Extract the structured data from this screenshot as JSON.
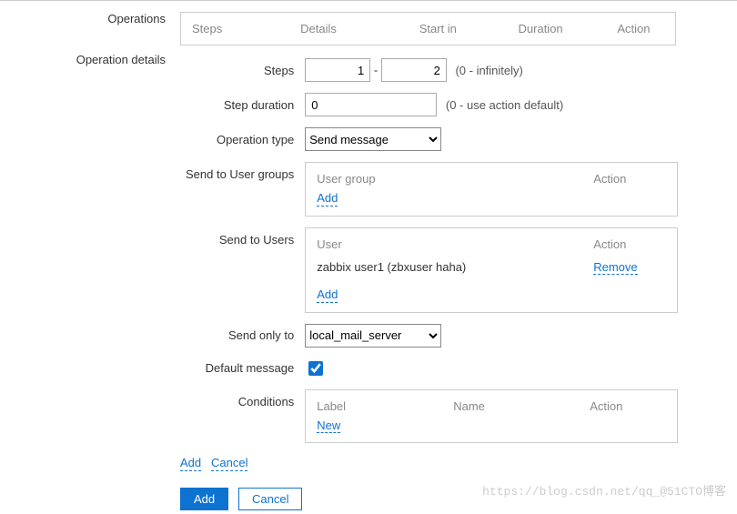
{
  "operations": {
    "label": "Operations",
    "headers": {
      "steps": "Steps",
      "details": "Details",
      "start_in": "Start in",
      "duration": "Duration",
      "action": "Action"
    }
  },
  "details": {
    "label": "Operation details",
    "steps": {
      "label": "Steps",
      "from": "1",
      "dash": "-",
      "to": "2",
      "hint": "(0 - infinitely)"
    },
    "step_duration": {
      "label": "Step duration",
      "value": "0",
      "hint": "(0 - use action default)"
    },
    "op_type": {
      "label": "Operation type",
      "value": "Send message"
    },
    "user_groups": {
      "label": "Send to User groups",
      "col_group": "User group",
      "col_action": "Action",
      "add": "Add"
    },
    "users": {
      "label": "Send to Users",
      "col_user": "User",
      "col_action": "Action",
      "rows": [
        {
          "name": "zabbix user1 (zbxuser haha)",
          "remove": "Remove"
        }
      ],
      "add": "Add"
    },
    "send_only_to": {
      "label": "Send only to",
      "value": "local_mail_server"
    },
    "default_message": {
      "label": "Default message",
      "checked": true
    },
    "conditions": {
      "label": "Conditions",
      "col_label": "Label",
      "col_name": "Name",
      "col_action": "Action",
      "new": "New"
    },
    "footer_links": {
      "add": "Add",
      "cancel": "Cancel"
    }
  },
  "buttons": {
    "add": "Add",
    "cancel": "Cancel"
  },
  "watermark": "https://blog.csdn.net/qq_@51CTO博客"
}
